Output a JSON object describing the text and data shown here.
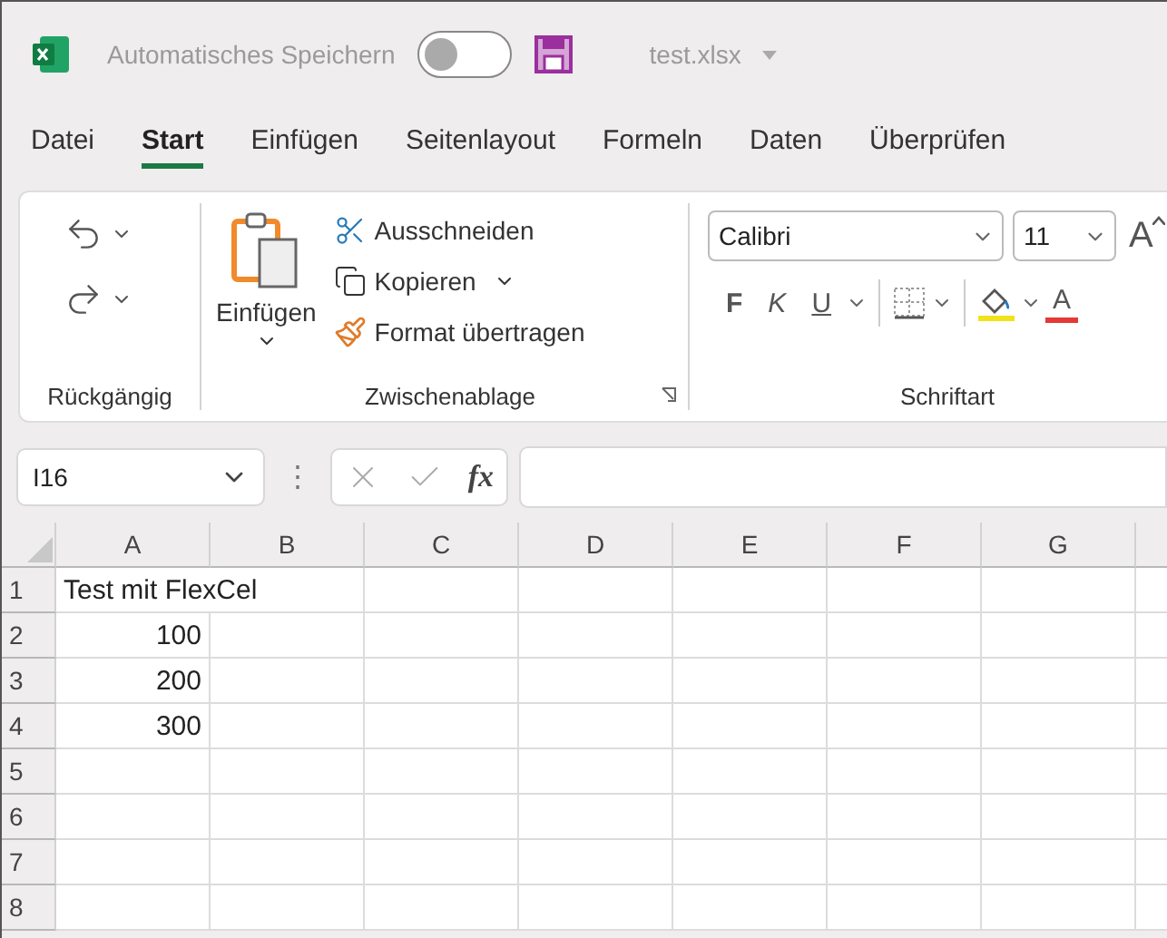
{
  "title_bar": {
    "autosave_label": "Automatisches Speichern",
    "autosave_on": false,
    "file_name": "test.xlsx"
  },
  "tabs": [
    {
      "label": "Datei",
      "selected": false
    },
    {
      "label": "Start",
      "selected": true
    },
    {
      "label": "Einfügen",
      "selected": false
    },
    {
      "label": "Seitenlayout",
      "selected": false
    },
    {
      "label": "Formeln",
      "selected": false
    },
    {
      "label": "Daten",
      "selected": false
    },
    {
      "label": "Überprüfen",
      "selected": false
    }
  ],
  "ribbon": {
    "undo_group": {
      "label": "Rückgängig"
    },
    "clipboard_group": {
      "label": "Zwischenablage",
      "paste": "Einfügen",
      "cut": "Ausschneiden",
      "copy": "Kopieren",
      "format_painter": "Format übertragen"
    },
    "font_group": {
      "label": "Schriftart",
      "font": "Calibri",
      "size": "11",
      "grow_font": "A",
      "bold": "F",
      "italic": "K",
      "underline": "U",
      "font_color": "A"
    }
  },
  "formula_bar": {
    "name_box": "I16",
    "more": "⋮",
    "function_label": "fx"
  },
  "sheet": {
    "columns": [
      "A",
      "B",
      "C",
      "D",
      "E",
      "F",
      "G"
    ],
    "rows": [
      {
        "label": "1",
        "cells": [
          {
            "text": "Test mit FlexCel",
            "kind": "text"
          }
        ]
      },
      {
        "label": "2",
        "cells": [
          {
            "text": "100",
            "kind": "number"
          }
        ]
      },
      {
        "label": "3",
        "cells": [
          {
            "text": "200",
            "kind": "number"
          }
        ]
      },
      {
        "label": "4",
        "cells": [
          {
            "text": "300",
            "kind": "number"
          }
        ]
      },
      {
        "label": "5",
        "cells": []
      },
      {
        "label": "6",
        "cells": []
      },
      {
        "label": "7",
        "cells": []
      },
      {
        "label": "8",
        "cells": []
      }
    ]
  }
}
